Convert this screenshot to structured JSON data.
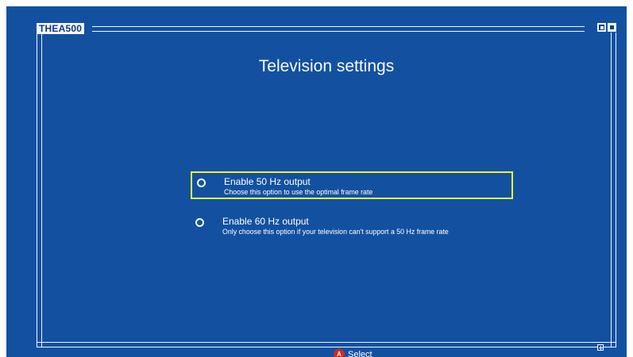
{
  "window": {
    "brand": "THEA500"
  },
  "page": {
    "title": "Television settings"
  },
  "options": [
    {
      "label": "Enable 50 Hz output",
      "description": "Choose this option to use the optimal frame rate",
      "state": "highlighted"
    },
    {
      "label": "Enable 60 Hz output",
      "description": "Only choose this option if your television can't support a 50 Hz frame rate",
      "state": "normal"
    }
  ],
  "footer": {
    "button_glyph": "A",
    "select_label": "Select"
  },
  "icons": {
    "window_controls": [
      "minimize-icon",
      "maximize-icon"
    ],
    "radio": "radio-button-icon",
    "corner": "resize-icon"
  },
  "colors": {
    "background": "#1351a0",
    "frame": "#f2f6ff",
    "highlight": "#f3ef3f",
    "a_button": "#d7281e"
  }
}
